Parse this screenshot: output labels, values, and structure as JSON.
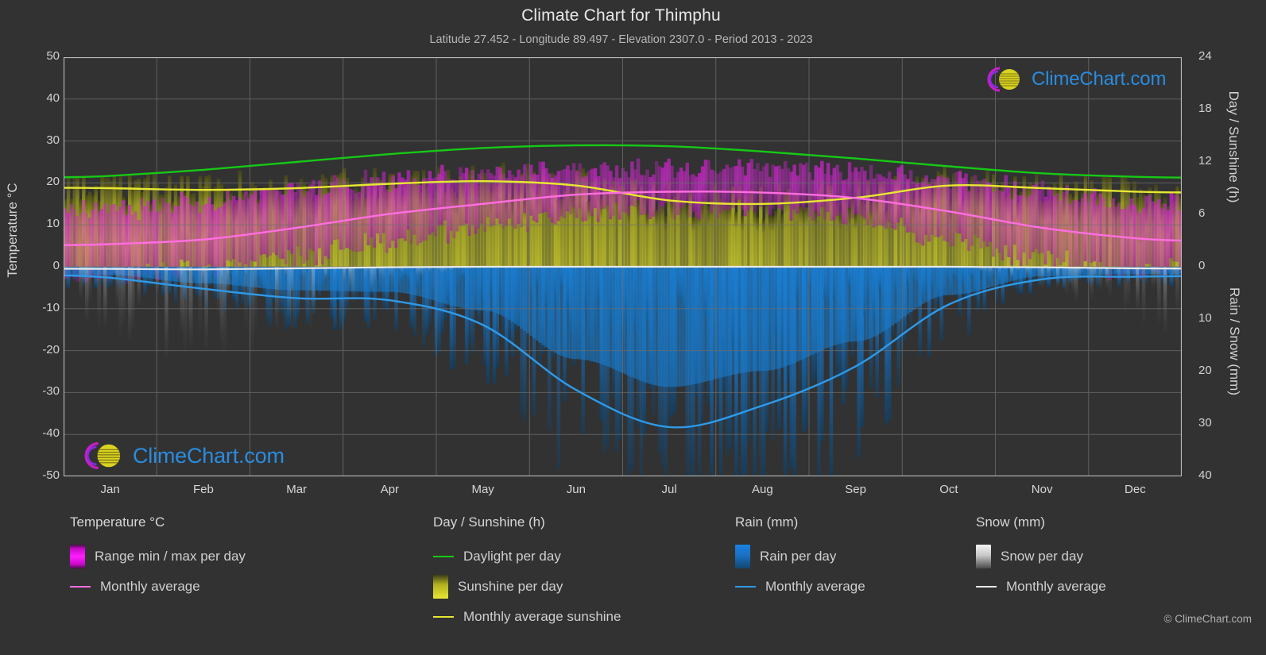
{
  "header": {
    "title": "Climate Chart for Thimphu",
    "subtitle": "Latitude 27.452 - Longitude 89.497 - Elevation 2307.0 - Period 2013 - 2023"
  },
  "branding": {
    "watermark_text": "ClimeChart.com",
    "copyright": "© ClimeChart.com"
  },
  "axes": {
    "left_title": "Temperature °C",
    "right_top_title": "Day / Sunshine (h)",
    "right_bottom_title": "Rain / Snow (mm)",
    "left_ticks": [
      "50",
      "40",
      "30",
      "20",
      "10",
      "0",
      "-10",
      "-20",
      "-30",
      "-40",
      "-50"
    ],
    "right_top_ticks": [
      "24",
      "18",
      "12",
      "6",
      "0"
    ],
    "right_bottom_ticks": [
      "0",
      "10",
      "20",
      "30",
      "40"
    ],
    "x_ticks": [
      "Jan",
      "Feb",
      "Mar",
      "Apr",
      "May",
      "Jun",
      "Jul",
      "Aug",
      "Sep",
      "Oct",
      "Nov",
      "Dec"
    ]
  },
  "legend": {
    "groups": [
      {
        "title": "Temperature °C",
        "items": [
          {
            "label": "Range min / max per day",
            "marker": "band",
            "style": "sw-temp"
          },
          {
            "label": "Monthly average",
            "marker": "line",
            "style": "ln-temp"
          }
        ]
      },
      {
        "title": "Day / Sunshine (h)",
        "items": [
          {
            "label": "Daylight per day",
            "marker": "line",
            "style": "ln-green"
          },
          {
            "label": "Sunshine per day",
            "marker": "band",
            "style": "sw-sun"
          },
          {
            "label": "Monthly average sunshine",
            "marker": "line",
            "style": "ln-yellow"
          }
        ]
      },
      {
        "title": "Rain (mm)",
        "items": [
          {
            "label": "Rain per day",
            "marker": "band",
            "style": "sw-rain"
          },
          {
            "label": "Monthly average",
            "marker": "line",
            "style": "ln-rain"
          }
        ]
      },
      {
        "title": "Snow (mm)",
        "items": [
          {
            "label": "Snow per day",
            "marker": "band",
            "style": "sw-snow"
          },
          {
            "label": "Monthly average",
            "marker": "line",
            "style": "ln-snow"
          }
        ]
      }
    ]
  },
  "colors": {
    "background": "#323232",
    "grid": "#6e6e6e",
    "daylight": "#16c916",
    "sunshine_avg": "#e7e733",
    "temperature_avg": "#ff6ee0",
    "rain_avg": "#2f9ae8",
    "snow_avg": "#e8e8e8",
    "logo_magenta": "#c81ec8",
    "logo_yellow": "#d9d321",
    "logo_blue": "#2a8ce0"
  },
  "chart_data": {
    "type": "area",
    "title": "Climate Chart for Thimphu",
    "subtitle": "Latitude 27.452 - Longitude 89.497 - Elevation 2307.0 - Period 2013 - 2023",
    "xlabel": "",
    "ylabel": "Temperature °C",
    "y2label_top": "Day / Sunshine (h)",
    "y2label_bottom": "Rain / Snow (mm)",
    "ylim": [
      -50,
      50
    ],
    "y2lim_top": [
      0,
      24
    ],
    "y2lim_bottom": [
      0,
      40
    ],
    "grid": true,
    "legend_position": "below",
    "categories": [
      "Jan",
      "Feb",
      "Mar",
      "Apr",
      "May",
      "Jun",
      "Jul",
      "Aug",
      "Sep",
      "Oct",
      "Nov",
      "Dec"
    ],
    "series": [
      {
        "name": "Daylight per day",
        "unit": "h",
        "axis": "right_top",
        "color": "#16c916",
        "values": [
          10.4,
          11.1,
          12.0,
          12.9,
          13.6,
          13.9,
          13.8,
          13.2,
          12.4,
          11.5,
          10.7,
          10.3
        ]
      },
      {
        "name": "Monthly average sunshine",
        "unit": "h",
        "axis": "right_top",
        "color": "#e7e733",
        "values": [
          9.0,
          8.8,
          9.0,
          9.5,
          9.8,
          9.3,
          7.6,
          7.2,
          7.9,
          9.3,
          9.0,
          8.6
        ]
      },
      {
        "name": "Temperature monthly average",
        "unit": "°C",
        "axis": "left",
        "color": "#ff6ee0",
        "values": [
          5.4,
          6.5,
          9.3,
          12.6,
          15.0,
          17.2,
          17.9,
          17.7,
          16.4,
          13.2,
          9.3,
          6.8
        ]
      },
      {
        "name": "Temperature range min / max per day",
        "unit": "°C",
        "axis": "left",
        "color": "#ff1fff",
        "min_values": [
          -1.0,
          0.2,
          3.1,
          7.0,
          10.3,
          13.4,
          14.6,
          14.3,
          12.6,
          7.6,
          2.8,
          0.2
        ],
        "max_values": [
          13.0,
          14.2,
          17.4,
          20.0,
          21.3,
          22.4,
          22.5,
          22.5,
          21.9,
          20.3,
          17.4,
          14.4
        ]
      },
      {
        "name": "Rain monthly average",
        "unit": "mm",
        "axis": "right_bottom",
        "color": "#2f9ae8",
        "values": [
          2.1,
          4.2,
          6.0,
          6.4,
          11.1,
          23.5,
          30.6,
          26.5,
          19.0,
          7.2,
          2.4,
          1.9
        ]
      },
      {
        "name": "Snow monthly average",
        "unit": "mm",
        "axis": "right_bottom",
        "color": "#e8e8e8",
        "values": [
          0.4,
          0.5,
          0.3,
          0.1,
          0.0,
          0.0,
          0.0,
          0.0,
          0.0,
          0.0,
          0.1,
          0.3
        ]
      }
    ]
  }
}
